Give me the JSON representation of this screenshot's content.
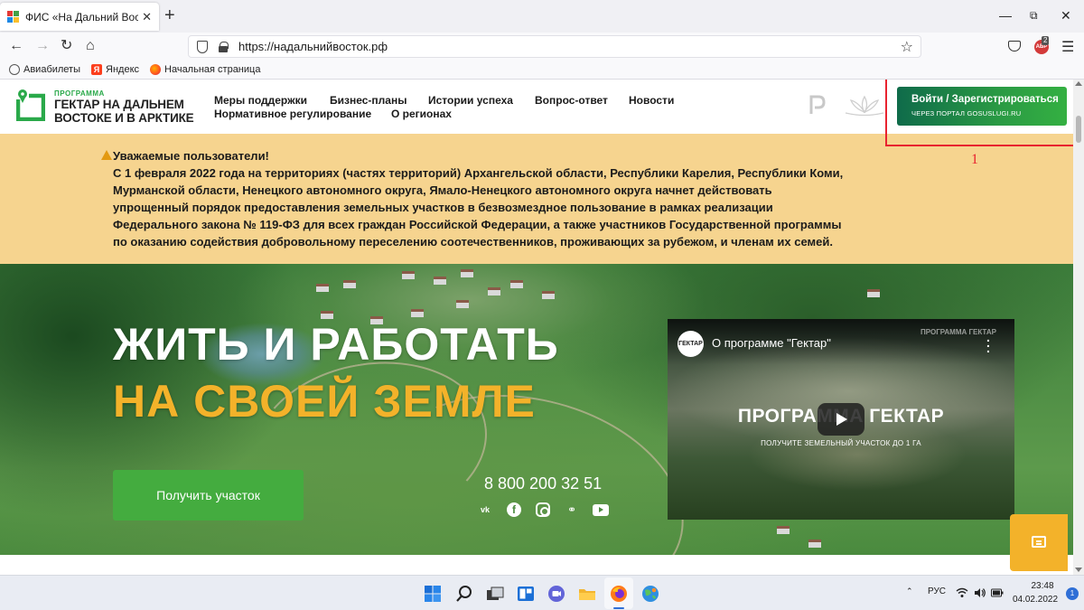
{
  "browser": {
    "tab_title": "ФИС «На Дальний Восток»",
    "tab_close": "✕",
    "new_tab": "+",
    "url": "https://надальнийвосток.рф",
    "addon_badge": "2",
    "addon_label": "ABP",
    "bookmarks": [
      {
        "label": "Авиабилеты",
        "icon": "globe-icon"
      },
      {
        "label": "Яндекс",
        "icon": "yandex-icon"
      },
      {
        "label": "Начальная страница",
        "icon": "firefox-icon"
      }
    ]
  },
  "site": {
    "logo": {
      "program": "ПРОГРАММА",
      "line1": "ГЕКТАР НА ДАЛЬНЕМ",
      "line2": "ВОСТОКЕ И В АРКТИКЕ"
    },
    "menu": [
      "Меры поддержки",
      "Бизнес-планы",
      "Истории успеха",
      "Вопрос-ответ",
      "Новости",
      "Нормативное регулирование",
      "О регионах"
    ],
    "login": {
      "main": "Войти / Зарегистрироваться",
      "sub": "ЧЕРЕЗ ПОРТАЛ GOSUSLUGI.RU"
    },
    "annotation_number": "1",
    "notice": {
      "title": "Уважаемые пользователи!",
      "lines": [
        "С 1 февраля 2022 года на территориях (частях территорий) Архангельской области, Республики Карелия, Республики Коми,",
        "Мурманской области, Ненецкого автономного округа, Ямало-Ненецкого автономного округа начнет действовать",
        "упрощенный порядок предоставления земельных участков в безвозмездное пользование в рамках реализации",
        "Федерального закона № 119-ФЗ для всех граждан Российской Федерации, а также участников Государственной программы",
        "по оказанию содействия добровольному переселению соотечественников, проживающих за рубежом, и членам их семей."
      ]
    },
    "hero": {
      "title_line1": "ЖИТЬ И РАБОТАТЬ",
      "title_line2": "НА СВОЕЙ ЗЕМЛЕ",
      "cta": "Получить участок",
      "phone": "8 800 200 32 51",
      "socials": [
        "vk-icon",
        "facebook-icon",
        "instagram-icon",
        "odnoklassniki-icon",
        "youtube-icon"
      ]
    },
    "video": {
      "channel": "ГЕКТАР",
      "title": "О программе \"Гектар\"",
      "brand": "ПРОГРАММА ГЕКТАР",
      "big_text": "ПРОГРАММА ГЕКТАР",
      "small_text": "ПОЛУЧИТЕ ЗЕМЕЛЬНЫЙ УЧАСТОК ДО 1 ГА"
    }
  },
  "taskbar": {
    "lang": "РУС",
    "time": "23:48",
    "date": "04.02.2022",
    "notifications": "1"
  },
  "colors": {
    "accent_green": "#44ac3f",
    "accent_yellow": "#f3b22a",
    "notice_bg": "#f6d48f",
    "highlight_red": "#e8232f"
  }
}
